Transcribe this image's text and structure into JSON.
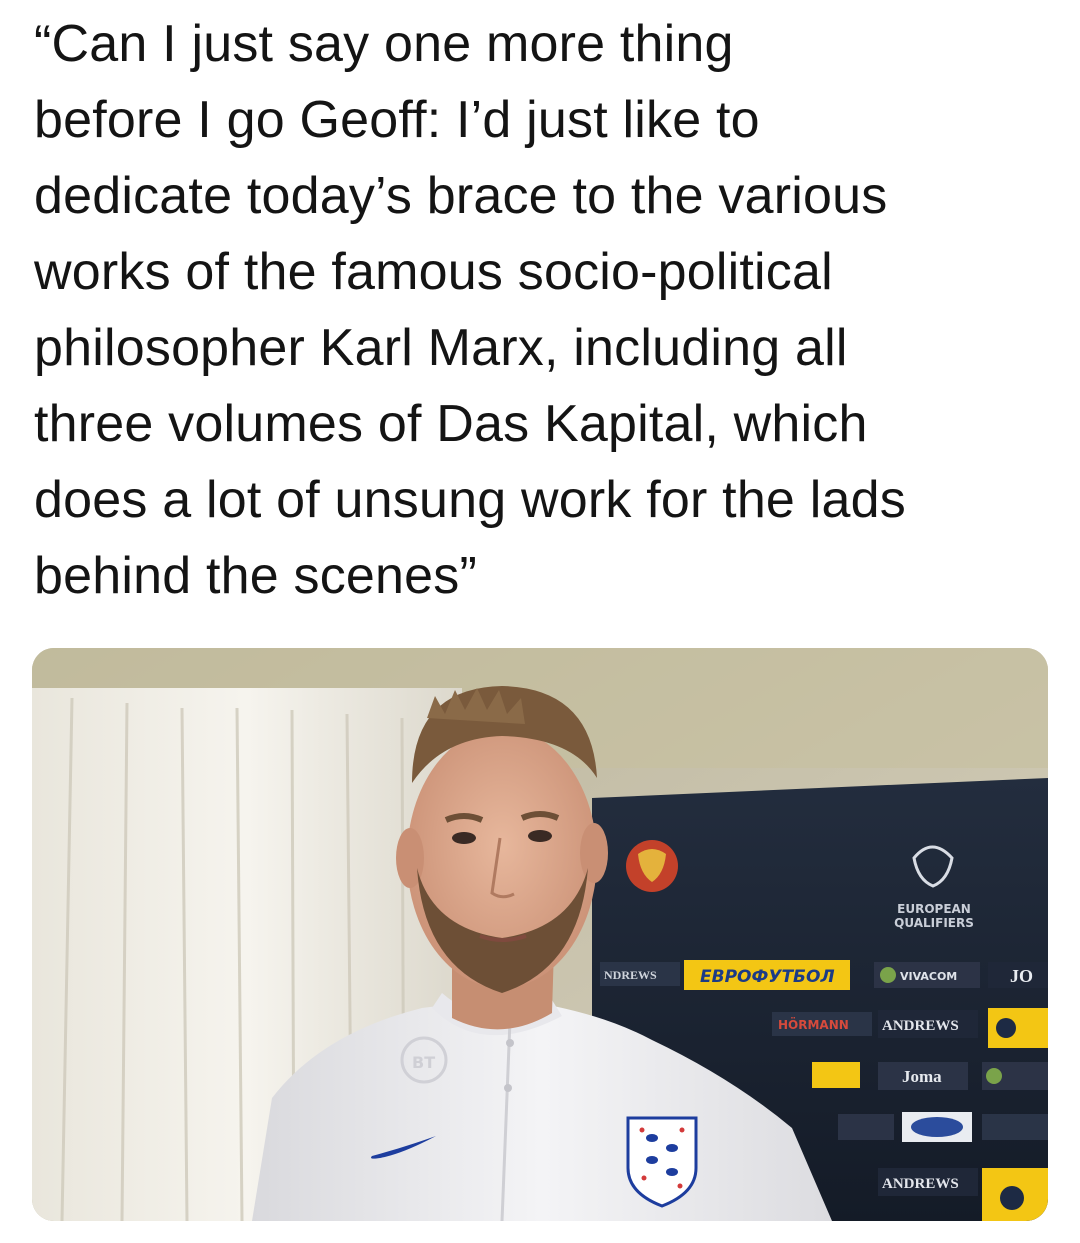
{
  "post": {
    "quote_text": "“Can I just say one more thing\nbefore I go Geoff: I’d just like to\ndedicate today’s brace to the various\nworks of the famous socio-political\nphilosopher Karl Marx, including all\nthree volumes of Das Kapital, which\ndoes a lot of unsung work for the lads\nbehind the scenes”"
  },
  "media": {
    "board": {
      "european": "EUROPEAN",
      "qualifiers": "QUALIFIERS",
      "evrofutbol": "ЕВРОФУТБОЛ",
      "vivacom": "VIVACOM",
      "joma": "Joma",
      "hormann": "HÖRMANN",
      "andrews": "ANDREWS",
      "andrews_short": "NDREWS",
      "jo": "JO",
      "bt": "BT"
    }
  },
  "colors": {
    "text": "#141414",
    "background": "#ffffff",
    "board": "#1b2433",
    "board_yellow": "#f3c614"
  }
}
